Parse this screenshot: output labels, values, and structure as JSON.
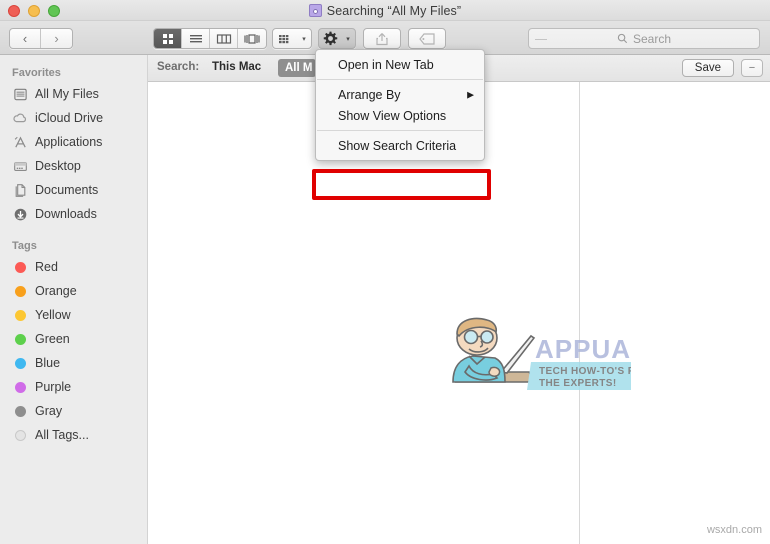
{
  "window": {
    "title": "Searching “All My Files”",
    "title_icon": "purple-folder-search-icon",
    "controls": [
      {
        "name": "close",
        "color": "#ef5f56"
      },
      {
        "name": "minimize",
        "color": "#f6be4f"
      },
      {
        "name": "maximize",
        "color": "#61c554"
      }
    ]
  },
  "toolbar": {
    "back_glyph": "‹",
    "forward_glyph": "›",
    "view_buttons": [
      {
        "name": "icon-view",
        "active": true
      },
      {
        "name": "list-view",
        "active": false
      },
      {
        "name": "column-view",
        "active": false
      },
      {
        "name": "coverflow-view",
        "active": false
      }
    ],
    "arrange_button": "arrange-by-button",
    "action_button": "gear-action-button",
    "share_button": "share-button",
    "tag_button": "tag-button",
    "chevron_glyph": "▾"
  },
  "search": {
    "placeholder": "Search",
    "icon": "magnifier-icon"
  },
  "criteria": {
    "label": "Search:",
    "scope": "This Mac",
    "chip": "All M",
    "save_label": "Save",
    "minus_label": "−"
  },
  "sidebar": {
    "sections": [
      {
        "header": "Favorites",
        "items": [
          {
            "label": "All My Files",
            "icon": "all-my-files-icon"
          },
          {
            "label": "iCloud Drive",
            "icon": "icloud-drive-icon"
          },
          {
            "label": "Applications",
            "icon": "applications-icon"
          },
          {
            "label": "Desktop",
            "icon": "desktop-icon"
          },
          {
            "label": "Documents",
            "icon": "documents-icon"
          },
          {
            "label": "Downloads",
            "icon": "downloads-icon"
          }
        ]
      },
      {
        "header": "Tags",
        "items": [
          {
            "label": "Red",
            "icon": "tag-dot-icon",
            "color": "#fc5a55"
          },
          {
            "label": "Orange",
            "icon": "tag-dot-icon",
            "color": "#f8a01c"
          },
          {
            "label": "Yellow",
            "icon": "tag-dot-icon",
            "color": "#fcc733"
          },
          {
            "label": "Green",
            "icon": "tag-dot-icon",
            "color": "#5dd04c"
          },
          {
            "label": "Blue",
            "icon": "tag-dot-icon",
            "color": "#3fb8f0"
          },
          {
            "label": "Purple",
            "icon": "tag-dot-icon",
            "color": "#d06ce8"
          },
          {
            "label": "Gray",
            "icon": "tag-dot-icon",
            "color": "#8e8e8e"
          },
          {
            "label": "All Tags...",
            "icon": "all-tags-icon",
            "color": "#e4e4e4"
          }
        ]
      }
    ]
  },
  "menu": {
    "items": [
      {
        "label": "Open in New Tab",
        "submenu": false
      },
      {
        "label": "Arrange By",
        "submenu": true
      },
      {
        "label": "Show View Options",
        "submenu": false
      },
      {
        "label": "Show Search Criteria",
        "submenu": false,
        "highlighted": true
      }
    ],
    "submenu_arrow": "▶",
    "highlight_color": "#e00000"
  },
  "watermark": {
    "logo_title": "APPUALS",
    "logo_tagline_line1": "TECH HOW-TO'S FROM",
    "logo_tagline_line2": "THE EXPERTS!",
    "footer": "wsxdn.com"
  }
}
